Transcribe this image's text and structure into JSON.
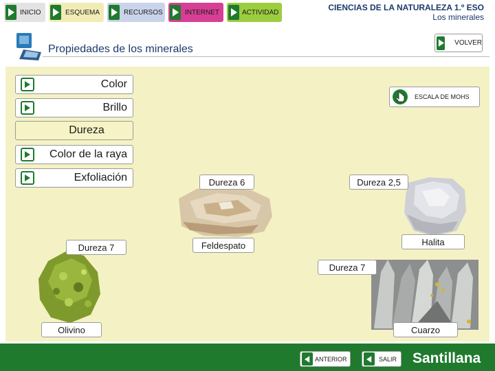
{
  "nav": {
    "inicio": "INICIO",
    "esquema": "ESQUEMA",
    "recursos": "RECURSOS",
    "internet": "INTERNET",
    "actividad": "ACTIVIDAD"
  },
  "header": {
    "course": "CIENCIAS DE LA NATURALEZA 1.º ESO",
    "unit": "Los minerales"
  },
  "page_title": "Propiedades de los minerales",
  "volver": "VOLVER",
  "properties": [
    {
      "label": "Color",
      "active": false
    },
    {
      "label": "Brillo",
      "active": false
    },
    {
      "label": "Dureza",
      "active": true
    },
    {
      "label": "Color de la raya",
      "active": false
    },
    {
      "label": "Exfoliación",
      "active": false
    }
  ],
  "mohs_button": "ESCALA DE MOHS",
  "minerals": [
    {
      "name": "Olivino",
      "hardness": "Dureza 7"
    },
    {
      "name": "Feldespato",
      "hardness": "Dureza 6"
    },
    {
      "name": "Halita",
      "hardness": "Dureza 2,5"
    },
    {
      "name": "Cuarzo",
      "hardness": "Dureza 7"
    }
  ],
  "footer": {
    "anterior": "ANTERIOR",
    "salir": "SALIR",
    "brand": "Santillana"
  },
  "colors": {
    "green": "#1f7a2e",
    "panel": "#f4f2c4",
    "nav_inicio": "#e3e3e3",
    "nav_esquema": "#f1ecb5",
    "nav_recursos": "#c9d3ea",
    "nav_internet": "#d63f95",
    "nav_actividad": "#9ccd3f"
  },
  "icons": [
    "play-icon",
    "monitor-icon",
    "pointer-hand-icon"
  ]
}
